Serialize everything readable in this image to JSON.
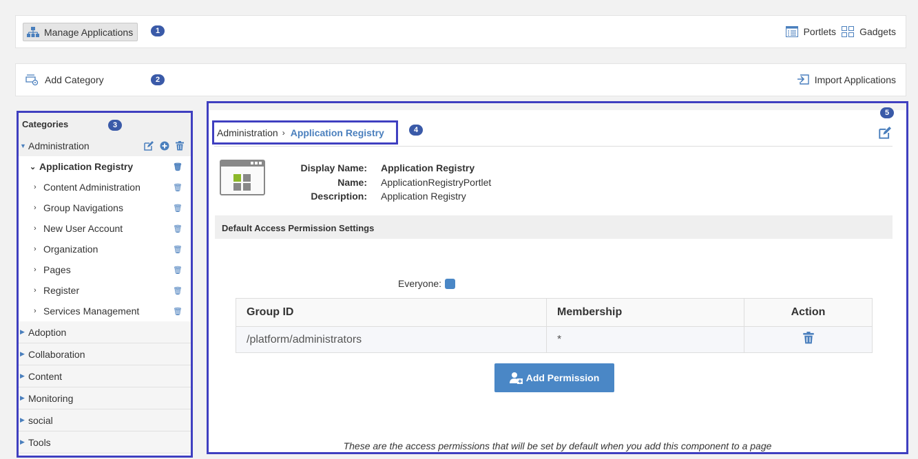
{
  "toolbar1": {
    "manage_label": "Manage Applications",
    "badge": "1",
    "portlets_label": "Portlets",
    "gadgets_label": "Gadgets"
  },
  "toolbar2": {
    "add_category_label": "Add Category",
    "badge": "2",
    "import_label": "Import Applications"
  },
  "categories": {
    "header": "Categories",
    "badge": "3",
    "open_category": "Administration",
    "open_subcategory": "Application Registry",
    "children": [
      "Content Administration",
      "Group Navigations",
      "New User Account",
      "Organization",
      "Pages",
      "Register",
      "Services Management"
    ],
    "others": [
      "Adoption",
      "Collaboration",
      "Content",
      "Monitoring",
      "social",
      "Tools"
    ]
  },
  "detail": {
    "badge_panel": "5",
    "badge_crumb": "4",
    "breadcrumb_parent": "Administration",
    "breadcrumb_current": "Application Registry",
    "display_name_label": "Display Name:",
    "display_name": "Application Registry",
    "name_label": "Name:",
    "name": "ApplicationRegistryPortlet",
    "description_label": "Description:",
    "description": "Application Registry",
    "permission_header": "Default Access Permission Settings",
    "everyone_label": "Everyone:",
    "table_headers": [
      "Group ID",
      "Membership",
      "Action"
    ],
    "rows": [
      {
        "group": "/platform/administrators",
        "membership": "*"
      }
    ],
    "add_permission_label": "Add Permission",
    "footnote": "These are the access permissions that will be set by default when you add this component to a page"
  },
  "colors": {
    "accent": "#4a7fbd",
    "highlight_border": "#3f3fc0",
    "badge": "#3a5aa8"
  }
}
